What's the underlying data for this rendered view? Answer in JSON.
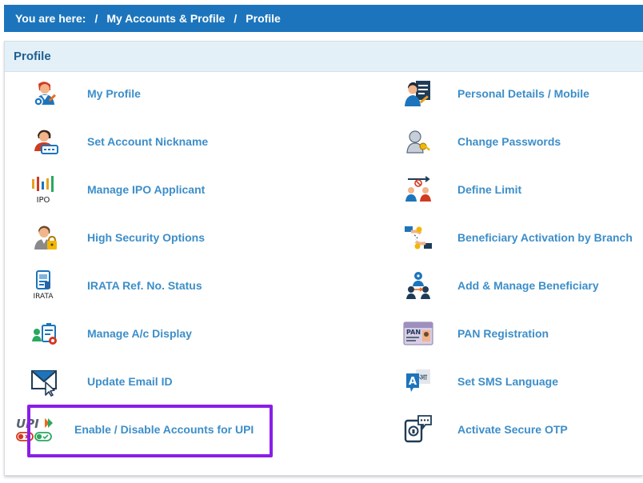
{
  "breadcrumb": {
    "prefix": "You are here:",
    "separator": "/",
    "level1": "My Accounts & Profile",
    "level2": "Profile"
  },
  "panel": {
    "title": "Profile"
  },
  "items_left": [
    {
      "label": "My Profile",
      "icon": "my-profile-icon"
    },
    {
      "label": "Set Account Nickname",
      "icon": "account-nickname-icon"
    },
    {
      "label": "Manage IPO Applicant",
      "icon": "ipo-icon",
      "icon_text": "IPO"
    },
    {
      "label": "High Security Options",
      "icon": "security-lock-icon"
    },
    {
      "label": "IRATA Ref. No. Status",
      "icon": "irata-icon",
      "icon_text": "IRATA"
    },
    {
      "label": "Manage A/c Display",
      "icon": "account-display-icon"
    },
    {
      "label": "Update Email ID",
      "icon": "email-icon"
    },
    {
      "label": "Enable / Disable Accounts for UPI",
      "icon": "upi-icon",
      "icon_text": "UPI"
    }
  ],
  "items_right": [
    {
      "label": "Personal Details / Mobile",
      "icon": "personal-details-icon"
    },
    {
      "label": "Change Passwords",
      "icon": "change-password-icon"
    },
    {
      "label": "Define Limit",
      "icon": "define-limit-icon"
    },
    {
      "label": "Beneficiary Activation by Branch",
      "icon": "beneficiary-activation-icon"
    },
    {
      "label": "Add & Manage Beneficiary",
      "icon": "manage-beneficiary-icon"
    },
    {
      "label": "PAN Registration",
      "icon": "pan-card-icon",
      "icon_text": "PAN"
    },
    {
      "label": "Set SMS Language",
      "icon": "sms-language-icon",
      "icon_text": "A",
      "icon_text_2": "आ"
    },
    {
      "label": "Activate Secure OTP",
      "icon": "secure-otp-icon"
    }
  ]
}
